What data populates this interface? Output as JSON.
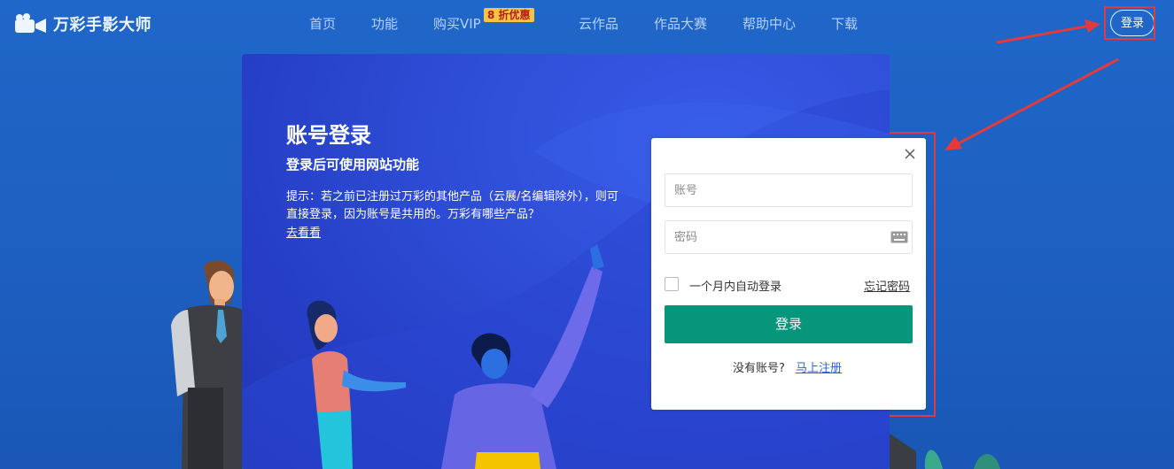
{
  "header": {
    "logo_text": "万彩手影大师",
    "nav": [
      "首页",
      "功能",
      "购买VIP",
      "云作品",
      "作品大赛",
      "帮助中心",
      "下载"
    ],
    "promo_badge": "8 折优惠",
    "login_button": "登录"
  },
  "login_card": {
    "title": "账号登录",
    "subtitle": "登录后可使用网站功能",
    "tip": "提示：若之前已注册过万彩的其他产品（云展/名编辑除外），则可直接登录，因为账号是共用的。万彩有哪些产品？",
    "tip_link": "去看看"
  },
  "modal": {
    "account_placeholder": "账号",
    "password_placeholder": "密码",
    "remember_label": "一个月内自动登录",
    "forgot_label": "忘记密码",
    "submit_label": "登录",
    "register_question": "没有账号?",
    "register_link": "马上注册"
  },
  "colors": {
    "background": "#1f67c9",
    "submit": "#07957c",
    "highlight": "#e33b3b",
    "link": "#2f62e0"
  },
  "icons": [
    "camera-logo-icon",
    "close-icon",
    "keyboard-icon",
    "checkbox-icon"
  ]
}
